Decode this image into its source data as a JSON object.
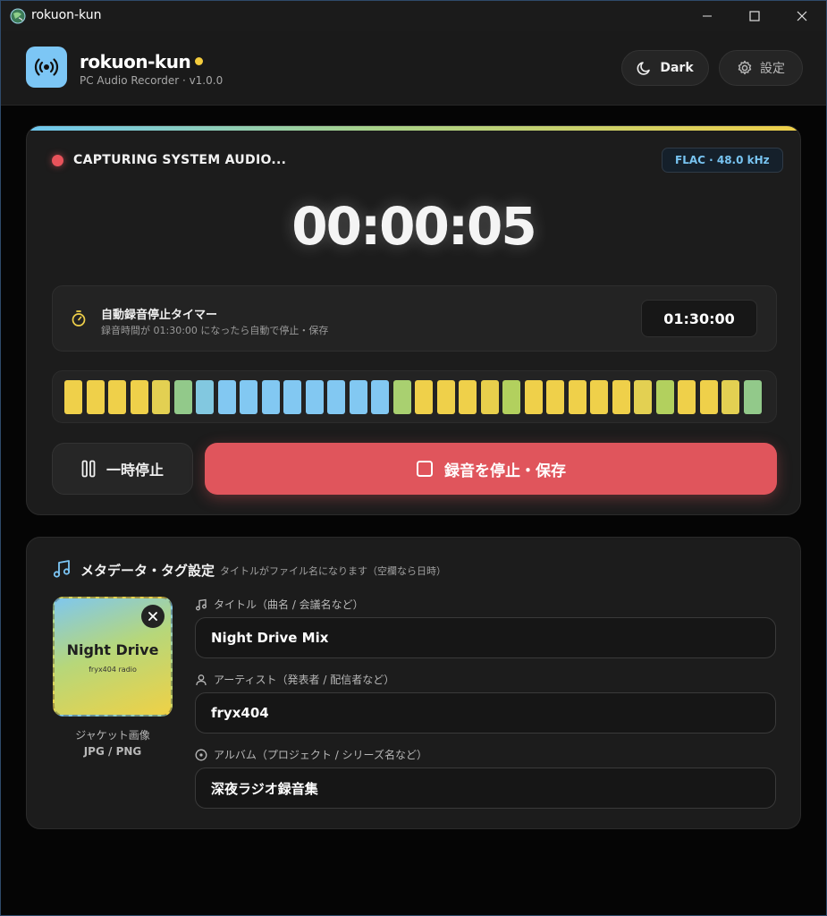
{
  "window": {
    "title": "rokuon-kun"
  },
  "header": {
    "brand": "rokuon-kun",
    "subtitle": "PC Audio Recorder · v1.0.0",
    "theme_label": "Dark",
    "settings_label": "設定"
  },
  "recorder": {
    "status": "CAPTURING SYSTEM AUDIO...",
    "format": "FLAC · 48.0 kHz",
    "elapsed": "00:00:05",
    "auto_stop": {
      "title": "自動録音停止タイマー",
      "description": "録音時間が 01:30:00 になったら自動で停止・保存",
      "time": "01:30:00"
    },
    "level_meter": {
      "bar_colors": [
        "#efd04a",
        "#efd04a",
        "#efd04a",
        "#efd04a",
        "#e3d052",
        "#92c98a",
        "#82c8e0",
        "#82c8f2",
        "#82c8f2",
        "#82c8f2",
        "#82c8f2",
        "#82c8f2",
        "#82c8f2",
        "#82c8f2",
        "#82c8f2",
        "#a9d070",
        "#efd04a",
        "#efd04a",
        "#efd04a",
        "#e8cf4c",
        "#b2d05e",
        "#efd04a",
        "#efd04a",
        "#efd04a",
        "#efd04a",
        "#efd04a",
        "#e3d052",
        "#b2d05e",
        "#efd04a",
        "#efd04a",
        "#e3d052",
        "#92c98a"
      ]
    },
    "pause_label": "一時停止",
    "stop_label": "録音を停止・保存",
    "accent_stop": "#e0555c"
  },
  "metadata": {
    "title": "メタデータ・タグ設定",
    "hint": "タイトルがファイル名になります（空欄なら日時）",
    "cover": {
      "title": "Night Drive",
      "subtitle": "fryx404 radio",
      "caption": "ジャケット画像",
      "formats": "JPG / PNG"
    },
    "fields": {
      "title_label": "タイトル（曲名 / 会議名など）",
      "title_value": "Night Drive Mix",
      "artist_label": "アーティスト（発表者 / 配信者など）",
      "artist_value": "fryx404",
      "album_label": "アルバム（プロジェクト / シリーズ名など）",
      "album_value": "深夜ラジオ録音集"
    }
  }
}
